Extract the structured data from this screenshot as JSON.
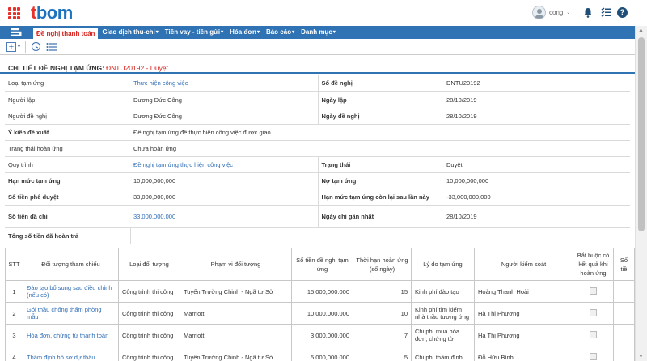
{
  "header": {
    "logo_part1": "t",
    "logo_part2": "bom",
    "username": "cong",
    "caret": "⌄",
    "help_label": "?"
  },
  "nav": {
    "home_icon": "stack-icon",
    "items": [
      {
        "label": "Đề nghị thanh toán",
        "has_dropdown": false
      },
      {
        "label": "Giao dịch thu-chi",
        "has_dropdown": true
      },
      {
        "label": "Tiền vay - tiền gửi",
        "has_dropdown": true
      },
      {
        "label": "Hóa đơn",
        "has_dropdown": true
      },
      {
        "label": "Báo cáo",
        "has_dropdown": true
      },
      {
        "label": "Danh mục",
        "has_dropdown": true
      }
    ],
    "dropdown_glyph": "▾"
  },
  "toolbar": {
    "add_glyph": "+",
    "add_caret": "▾",
    "history_glyph": "↺",
    "list_glyph": "☰"
  },
  "page": {
    "title": "CHI TIẾT ĐỀ NGHỊ TẠM ỨNG:",
    "code": "ĐNTU20192 - Duyệt"
  },
  "info": {
    "loai_tam_ung_label": "Loại tạm ứng",
    "loai_tam_ung_value": "Thực hiện công việc",
    "so_de_nghi_label": "Số đề nghị",
    "so_de_nghi_value": "ĐNTU20192",
    "nguoi_lap_label": "Người lập",
    "nguoi_lap_value": "Dương Đức Công",
    "ngay_lap_label": "Ngày lập",
    "ngay_lap_value": "28/10/2019",
    "nguoi_de_nghi_label": "Người đề nghị",
    "nguoi_de_nghi_value": "Dương Đức Công",
    "ngay_de_nghi_label": "Ngày đề nghị",
    "ngay_de_nghi_value": "28/10/2019",
    "y_kien_label": "Ý kiến đề xuất",
    "y_kien_value": "Đề nghị tạm ứng để thực hiện công việc được giao",
    "trang_thai_hoan_ung_label": "Trạng thái hoàn ứng",
    "trang_thai_hoan_ung_value": "Chưa hoàn ứng",
    "quy_trinh_label": "Quy trình",
    "quy_trinh_value": "Đề nghị tạm ứng thực hiện công việc",
    "trang_thai_label": "Trạng thái",
    "trang_thai_value": "Duyệt",
    "han_muc_label": "Hạn mức tạm ứng",
    "han_muc_value": "10,000,000,000",
    "no_tam_ung_label": "Nợ tạm ứng",
    "no_tam_ung_value": "10,000,000,000",
    "so_tien_phe_duyet_label": "Số tiền phê duyệt",
    "so_tien_phe_duyet_value": "33,000,000,000",
    "han_muc_con_lai_label": "Hạn mức tạm ứng còn lại sau lần này",
    "han_muc_con_lai_value": "-33,000,000,000",
    "so_tien_da_chi_label": "Số tiền đã chi",
    "so_tien_da_chi_value": "33,000,000,000",
    "ngay_chi_label": "Ngày chi gần nhất",
    "ngay_chi_value": "28/10/2019",
    "tong_hoan_tra_label": "Tổng số tiền đã hoàn trả",
    "tong_hoan_tra_value": ""
  },
  "detail": {
    "headers": [
      "STT",
      "Đối tượng tham chiếu",
      "Loại đối tượng",
      "Phạm vi đối tượng",
      "Số tiền đề nghị tạm ứng",
      "Thời hạn hoàn ứng (số ngày)",
      "Lý do tạm ứng",
      "Người kiểm soát",
      "Bắt buộc có kết quả khi hoàn ứng",
      "Số tiề"
    ],
    "rows": [
      {
        "stt": "1",
        "doi_tuong": "Đào tạo bổ sung sau điều chỉnh (nếu có)",
        "loai": "Công trình thi công",
        "pham_vi": "Tuyến Trường Chinh - Ngã tư Sở",
        "so_tien": "15,000,000.000",
        "thoi_han": "15",
        "ly_do": "Kinh phí đào tạo",
        "nguoi_ks": "Hoàng Thanh Hoài"
      },
      {
        "stt": "2",
        "doi_tuong": "Gói thầu chống thấm phòng mẫu",
        "loai": "Công trình thi công",
        "pham_vi": "Marriott",
        "so_tien": "10,000,000.000",
        "thoi_han": "10",
        "ly_do": "Kinh phí tìm kiếm nhà thầu tương ứng",
        "nguoi_ks": "Hà Thị Phương"
      },
      {
        "stt": "3",
        "doi_tuong": "Hóa đơn, chứng từ thanh toán",
        "loai": "Công trình thi công",
        "pham_vi": "Marriott",
        "so_tien": "3,000,000.000",
        "thoi_han": "7",
        "ly_do": "Chi phí mua hóa đơn, chứng từ",
        "nguoi_ks": "Hà Thị Phương"
      },
      {
        "stt": "4",
        "doi_tuong": "Thẩm định hồ sơ dự thầu",
        "loai": "Công trình thi công",
        "pham_vi": "Tuyến Trường Chinh - Ngã tư Sở",
        "so_tien": "5,000,000.000",
        "thoi_han": "5",
        "ly_do": "Chi phí thẩm định",
        "nguoi_ks": "Đỗ Hữu Bình"
      }
    ]
  },
  "colors": {
    "brand_red": "#e8312a",
    "brand_blue": "#1e73be",
    "nav_blue": "#2f73b5",
    "active_red": "#d6221c",
    "link_blue": "#2f6db5"
  }
}
